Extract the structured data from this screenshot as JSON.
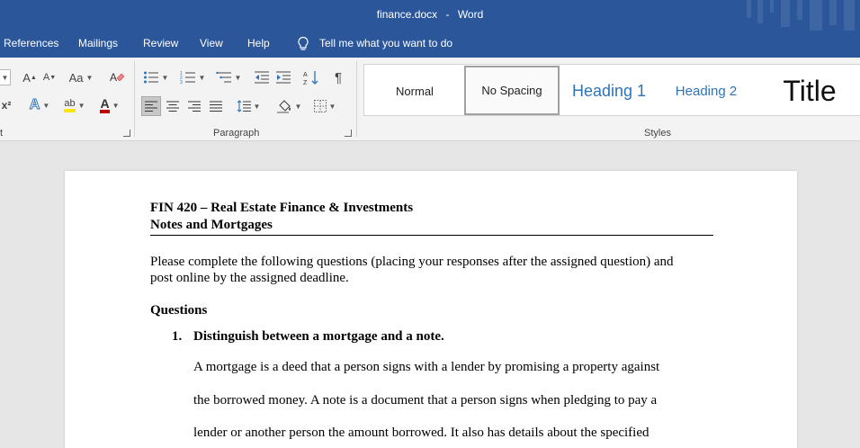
{
  "window": {
    "title": "finance.docx",
    "separator": "-",
    "app": "Word"
  },
  "tabs": [
    "References",
    "Mailings",
    "Review",
    "View",
    "Help"
  ],
  "tell_me": "Tell me what you want to do",
  "ribbon": {
    "font_group_label_fragment": "t",
    "paragraph_group_label": "Paragraph",
    "styles_group_label": "Styles",
    "change_case_label": "Aa",
    "grow_font_label": "A",
    "shrink_font_label": "A",
    "text_effects_label": "A",
    "font_color_label": "A",
    "highlight_label": "ab",
    "superscript_label": "x²",
    "pilcrow": "¶"
  },
  "styles": [
    {
      "name": "Normal"
    },
    {
      "name": "No Spacing",
      "selected": true
    },
    {
      "name": "Heading 1"
    },
    {
      "name": "Heading 2"
    },
    {
      "name": "Title"
    }
  ],
  "colors": {
    "accent": "#2b579a",
    "heading": "#2e74b5",
    "highlight": "#ffe600",
    "font_color": "#c00000"
  },
  "document": {
    "title_line1": "FIN 420 – Real Estate Finance & Investments",
    "title_line2": "Notes and Mortgages",
    "intro_line1": "Please complete the following questions (placing your responses after the assigned question) and",
    "intro_line2": "post online by the assigned deadline.",
    "questions_heading": "Questions",
    "q1_number": "1.",
    "q1_text": "Distinguish between a mortgage and a note.",
    "answer_lines": [
      "A mortgage is a deed that a person signs with a lender by promising a property against",
      "the borrowed money. A note is a document that a person signs when pledging to pay a",
      "lender or another person the amount borrowed. It also has details about the specified"
    ]
  }
}
